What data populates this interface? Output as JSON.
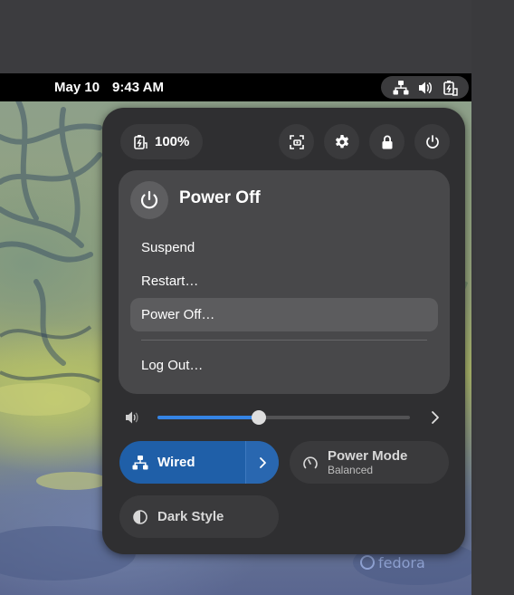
{
  "topbar": {
    "date": "May 10",
    "time": "9:43 AM",
    "status_icons": [
      "network-wired-icon",
      "volume-icon",
      "battery-charging-icon"
    ]
  },
  "quick_settings": {
    "battery_label": "100%",
    "header_buttons": [
      "screenshot-icon",
      "settings-icon",
      "lock-icon",
      "power-icon"
    ],
    "power_menu": {
      "title": "Power Off",
      "items": [
        "Suspend",
        "Restart…",
        "Power Off…",
        "Log Out…"
      ],
      "active_item": "Power Off…"
    },
    "volume": {
      "level": 0.4
    },
    "toggles": {
      "wired": {
        "label": "Wired",
        "active": true
      },
      "power_mode": {
        "label": "Power Mode",
        "sublabel": "Balanced"
      },
      "dark_style": {
        "label": "Dark Style"
      }
    }
  },
  "wallpaper": {
    "brand": "fedora"
  },
  "colors": {
    "accent": "#3584e4",
    "panel": "#2f2f31",
    "wired_active": "#1f5fa8"
  }
}
